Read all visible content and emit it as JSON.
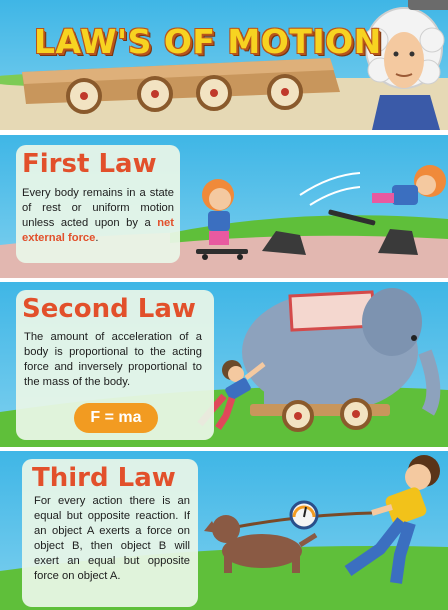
{
  "header": {
    "title": "LAW'S OF MOTION"
  },
  "laws": [
    {
      "title": "First Law",
      "body_before": "Every body remains in a state of rest or uniform motion unless acted upon by a",
      "body_highlight": "net external force",
      "body_after": "."
    },
    {
      "title": "Second Law",
      "body": "The amount of acceleration of a body is proportional to the acting force and inversely proportional to the mass of the body.",
      "formula": "F = ma"
    },
    {
      "title": "Third Law",
      "body": "For every action there is an equal but opposite reaction. If an object A exerts a force on object B, then object B will exert an equal but opposite force on object A."
    }
  ],
  "colors": {
    "title_yellow": "#f7d321",
    "law_orange": "#e2502b",
    "formula_bg": "#f29b21",
    "sky": "#3fb6e6",
    "grass": "#5fbf3a",
    "ground": "#e2b7b0"
  }
}
